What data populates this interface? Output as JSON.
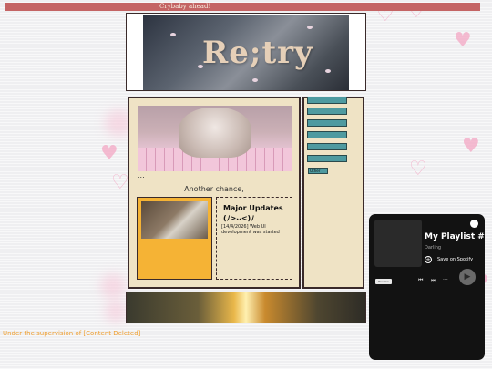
{
  "marquee": {
    "text": "Crybaby ahead!"
  },
  "banner": {
    "title": "Re;try"
  },
  "main": {
    "ellipsis": "...",
    "tagline": "Another chance,",
    "updates": {
      "heading": "Major Updates",
      "kaomoji": "(ﾉ>ᴗ<)ﾉ",
      "entry": "[14/4/2026] Web UI development was started"
    }
  },
  "side": {
    "select_label": "Other"
  },
  "footer": {
    "credit": "Under the supervision of [Content Deleted]"
  },
  "player": {
    "title": "My Playlist #",
    "owner": "Darling",
    "save_label": "Save on Spotify",
    "preview_label": "Preview",
    "more_label": "···"
  },
  "colors": {
    "accent_teal": "#4e9aa0",
    "card_orange": "#f5b335",
    "panel_cream": "#efe3c5",
    "marquee_red": "#c46464",
    "credit_orange": "#f0a030"
  },
  "icons": {
    "spotify": "spotify-logo-icon",
    "save": "plus-circle-icon",
    "prev": "skip-back-icon",
    "next": "skip-forward-icon",
    "play": "play-icon"
  }
}
